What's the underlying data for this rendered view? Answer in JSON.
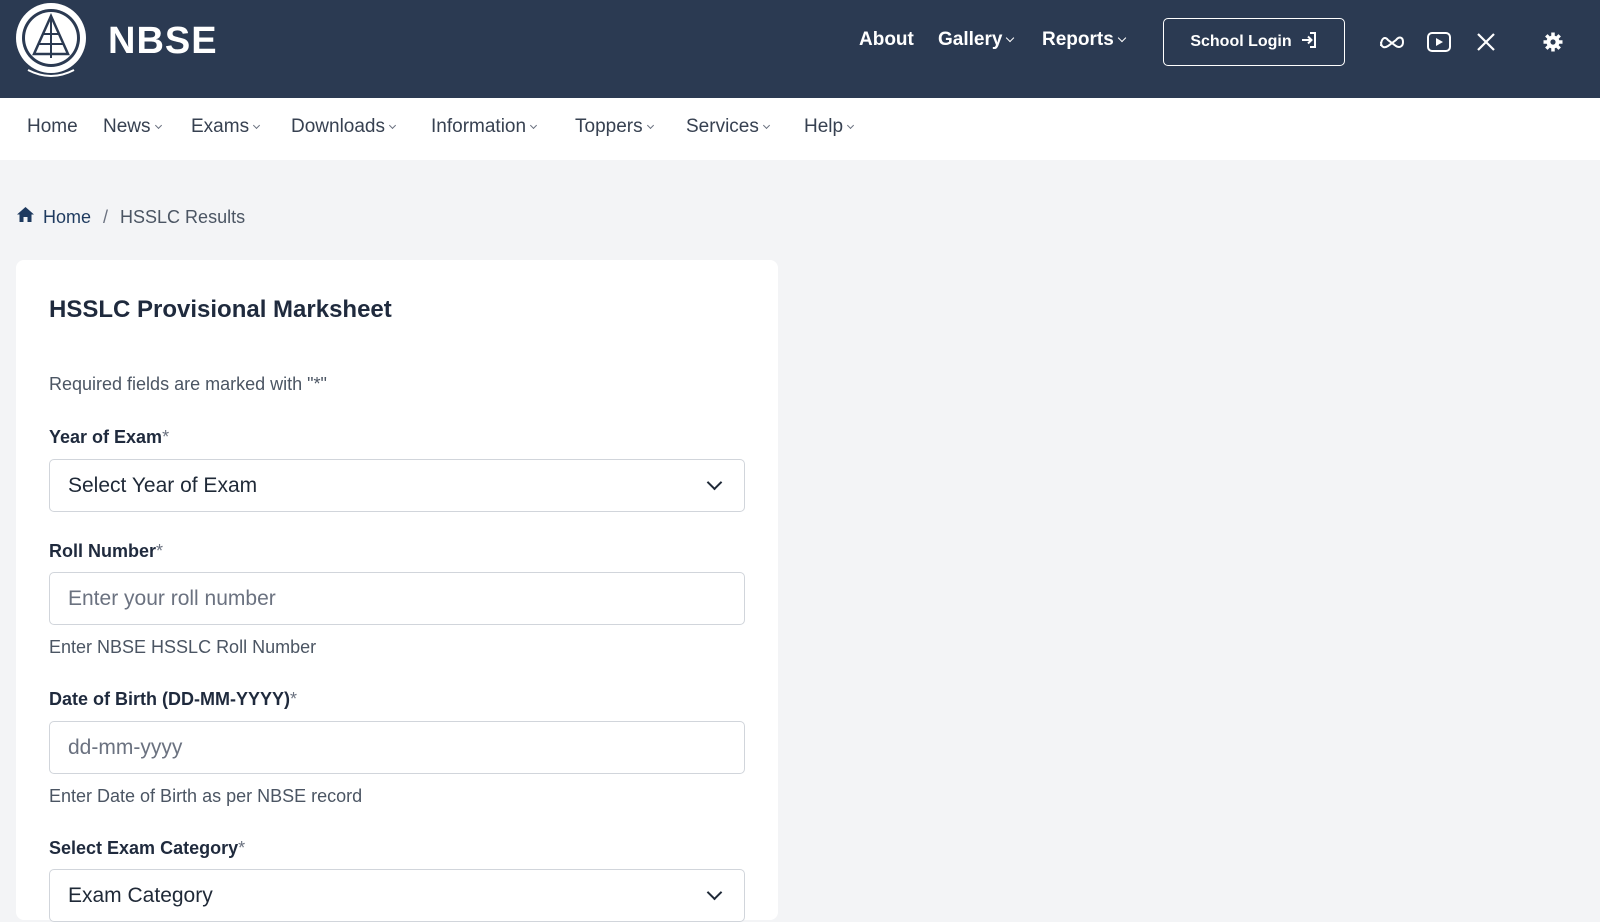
{
  "header": {
    "brand": "NBSE",
    "logo_text": "NAGALAND BOARD OF SCHOOL EDUCATION · Labour and honour",
    "nav": [
      {
        "label": "About",
        "has_dropdown": false
      },
      {
        "label": "Gallery",
        "has_dropdown": true
      },
      {
        "label": "Reports",
        "has_dropdown": true
      }
    ],
    "login_label": "School Login",
    "social_icons": [
      "meta-icon",
      "youtube-icon",
      "x-icon",
      "settings-icon"
    ]
  },
  "subnav": {
    "items": [
      {
        "label": "Home",
        "has_dropdown": false
      },
      {
        "label": "News",
        "has_dropdown": true
      },
      {
        "label": "Exams",
        "has_dropdown": true
      },
      {
        "label": "Downloads",
        "has_dropdown": true
      },
      {
        "label": "Information",
        "has_dropdown": true
      },
      {
        "label": "Toppers",
        "has_dropdown": true
      },
      {
        "label": "Services",
        "has_dropdown": true
      },
      {
        "label": "Help",
        "has_dropdown": true
      }
    ]
  },
  "breadcrumb": {
    "home": "Home",
    "separator": "/",
    "current": "HSSLC Results"
  },
  "form": {
    "title": "HSSLC Provisional Marksheet",
    "required_note": "Required fields are marked with \"*\"",
    "required_marker": "*",
    "year": {
      "label": "Year of Exam",
      "selected": "Select Year of Exam"
    },
    "roll": {
      "label": "Roll Number",
      "placeholder": "Enter your roll number",
      "help": "Enter NBSE HSSLC Roll Number"
    },
    "dob": {
      "label": "Date of Birth (DD-MM-YYYY)",
      "placeholder": "dd-mm-yyyy",
      "help": "Enter Date of Birth as per NBSE record"
    },
    "category": {
      "label": "Select Exam Category",
      "selected": "Exam Category"
    }
  },
  "colors": {
    "header_bg": "#2b3a52",
    "page_bg": "#f3f4f6",
    "card_bg": "#ffffff",
    "text_dark": "#1f2a3d"
  }
}
